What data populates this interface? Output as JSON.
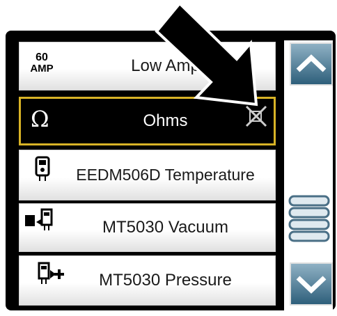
{
  "list": {
    "items": [
      {
        "icon_text": "60\nAMP",
        "label": "Low Amp"
      },
      {
        "icon_text": "Ω",
        "label": "Ohms"
      },
      {
        "label": "EEDM506D Temperature"
      },
      {
        "label": "MT5030 Vacuum"
      },
      {
        "label": "MT5030 Pressure"
      }
    ]
  },
  "colors": {
    "accent": "#d8b326",
    "scroll": "#2e5f7b",
    "frame": "#000000"
  }
}
